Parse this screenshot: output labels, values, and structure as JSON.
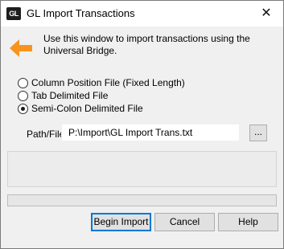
{
  "window": {
    "title": "GL Import Transactions",
    "app_icon_text": "GL",
    "close_glyph": "✕"
  },
  "intro": {
    "icon": "left-arrow-icon",
    "text": "Use this window to import transactions using the Universal Bridge."
  },
  "file_types": {
    "options": [
      {
        "label": "Column Position File (Fixed Length)",
        "selected": false
      },
      {
        "label": "Tab Delimited File",
        "selected": false
      },
      {
        "label": "Semi-Colon Delimited File",
        "selected": true
      }
    ]
  },
  "path": {
    "label": "Path/File",
    "value": "P:\\Import\\GL Import Trans.txt",
    "browse_label": "..."
  },
  "message": "",
  "progress": 0,
  "buttons": {
    "begin_import": "Begin Import",
    "cancel": "Cancel",
    "help": "Help"
  },
  "colors": {
    "arrow": "#f7941d",
    "default_button_border": "#0078d7"
  }
}
